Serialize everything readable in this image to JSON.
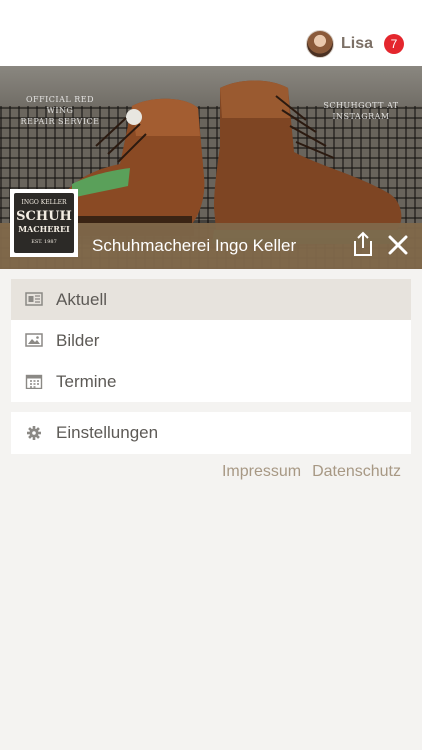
{
  "header": {
    "user_name": "Lisa",
    "notification_count": "7",
    "avatar": "user-avatar"
  },
  "hero": {
    "overlay_left": "OFFICIAL RED WING\nREPAIR SERVICE",
    "overlay_right": "SCHUHGOTT AT\nINSTAGRAM",
    "logo_lines": [
      "INGO KELLER",
      "SCHUH",
      "MACHEREI",
      "EST. 1987"
    ]
  },
  "shop": {
    "title": "Schuhmacherei Ingo Keller",
    "share_icon": "share-icon",
    "close_icon": "close-icon"
  },
  "menu": {
    "items": [
      {
        "label": "Aktuell",
        "icon": "newspaper-icon",
        "active": true
      },
      {
        "label": "Bilder",
        "icon": "image-icon",
        "active": false
      },
      {
        "label": "Termine",
        "icon": "calendar-icon",
        "active": false
      }
    ],
    "settings": {
      "label": "Einstellungen",
      "icon": "gear-icon"
    }
  },
  "footer_links": {
    "impressum": "Impressum",
    "datenschutz": "Datenschutz"
  },
  "colors": {
    "brand_brown": "#80684a",
    "badge_red": "#e4262d",
    "link_color": "#a79884",
    "active_row": "#e7e3dd"
  }
}
